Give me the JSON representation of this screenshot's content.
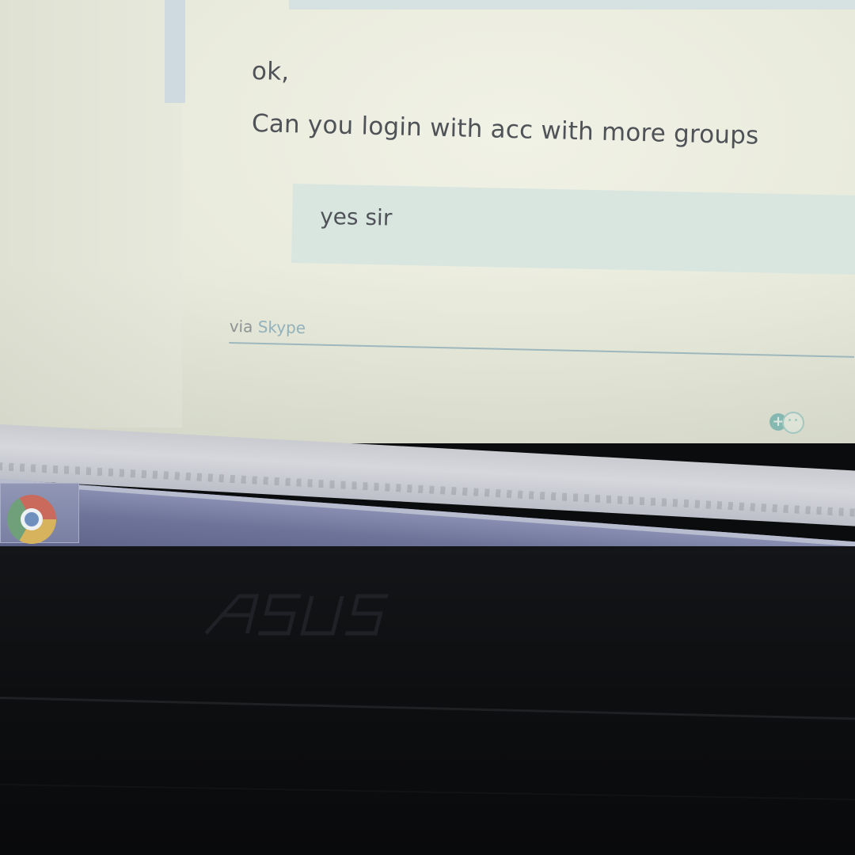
{
  "chat": {
    "messages": [
      {
        "text": "ok,"
      },
      {
        "text": "Can you login with acc with more groups"
      }
    ],
    "reply": {
      "text": "yes sir"
    },
    "footer": {
      "via_prefix": "via",
      "via_link": "Skype"
    },
    "emoticon_button_icon": "add-emoticon-icon"
  },
  "taskbar": {
    "pinned": [
      {
        "icon": "chrome-icon"
      }
    ]
  },
  "device": {
    "brand_logo_icon": "asus-logo"
  }
}
